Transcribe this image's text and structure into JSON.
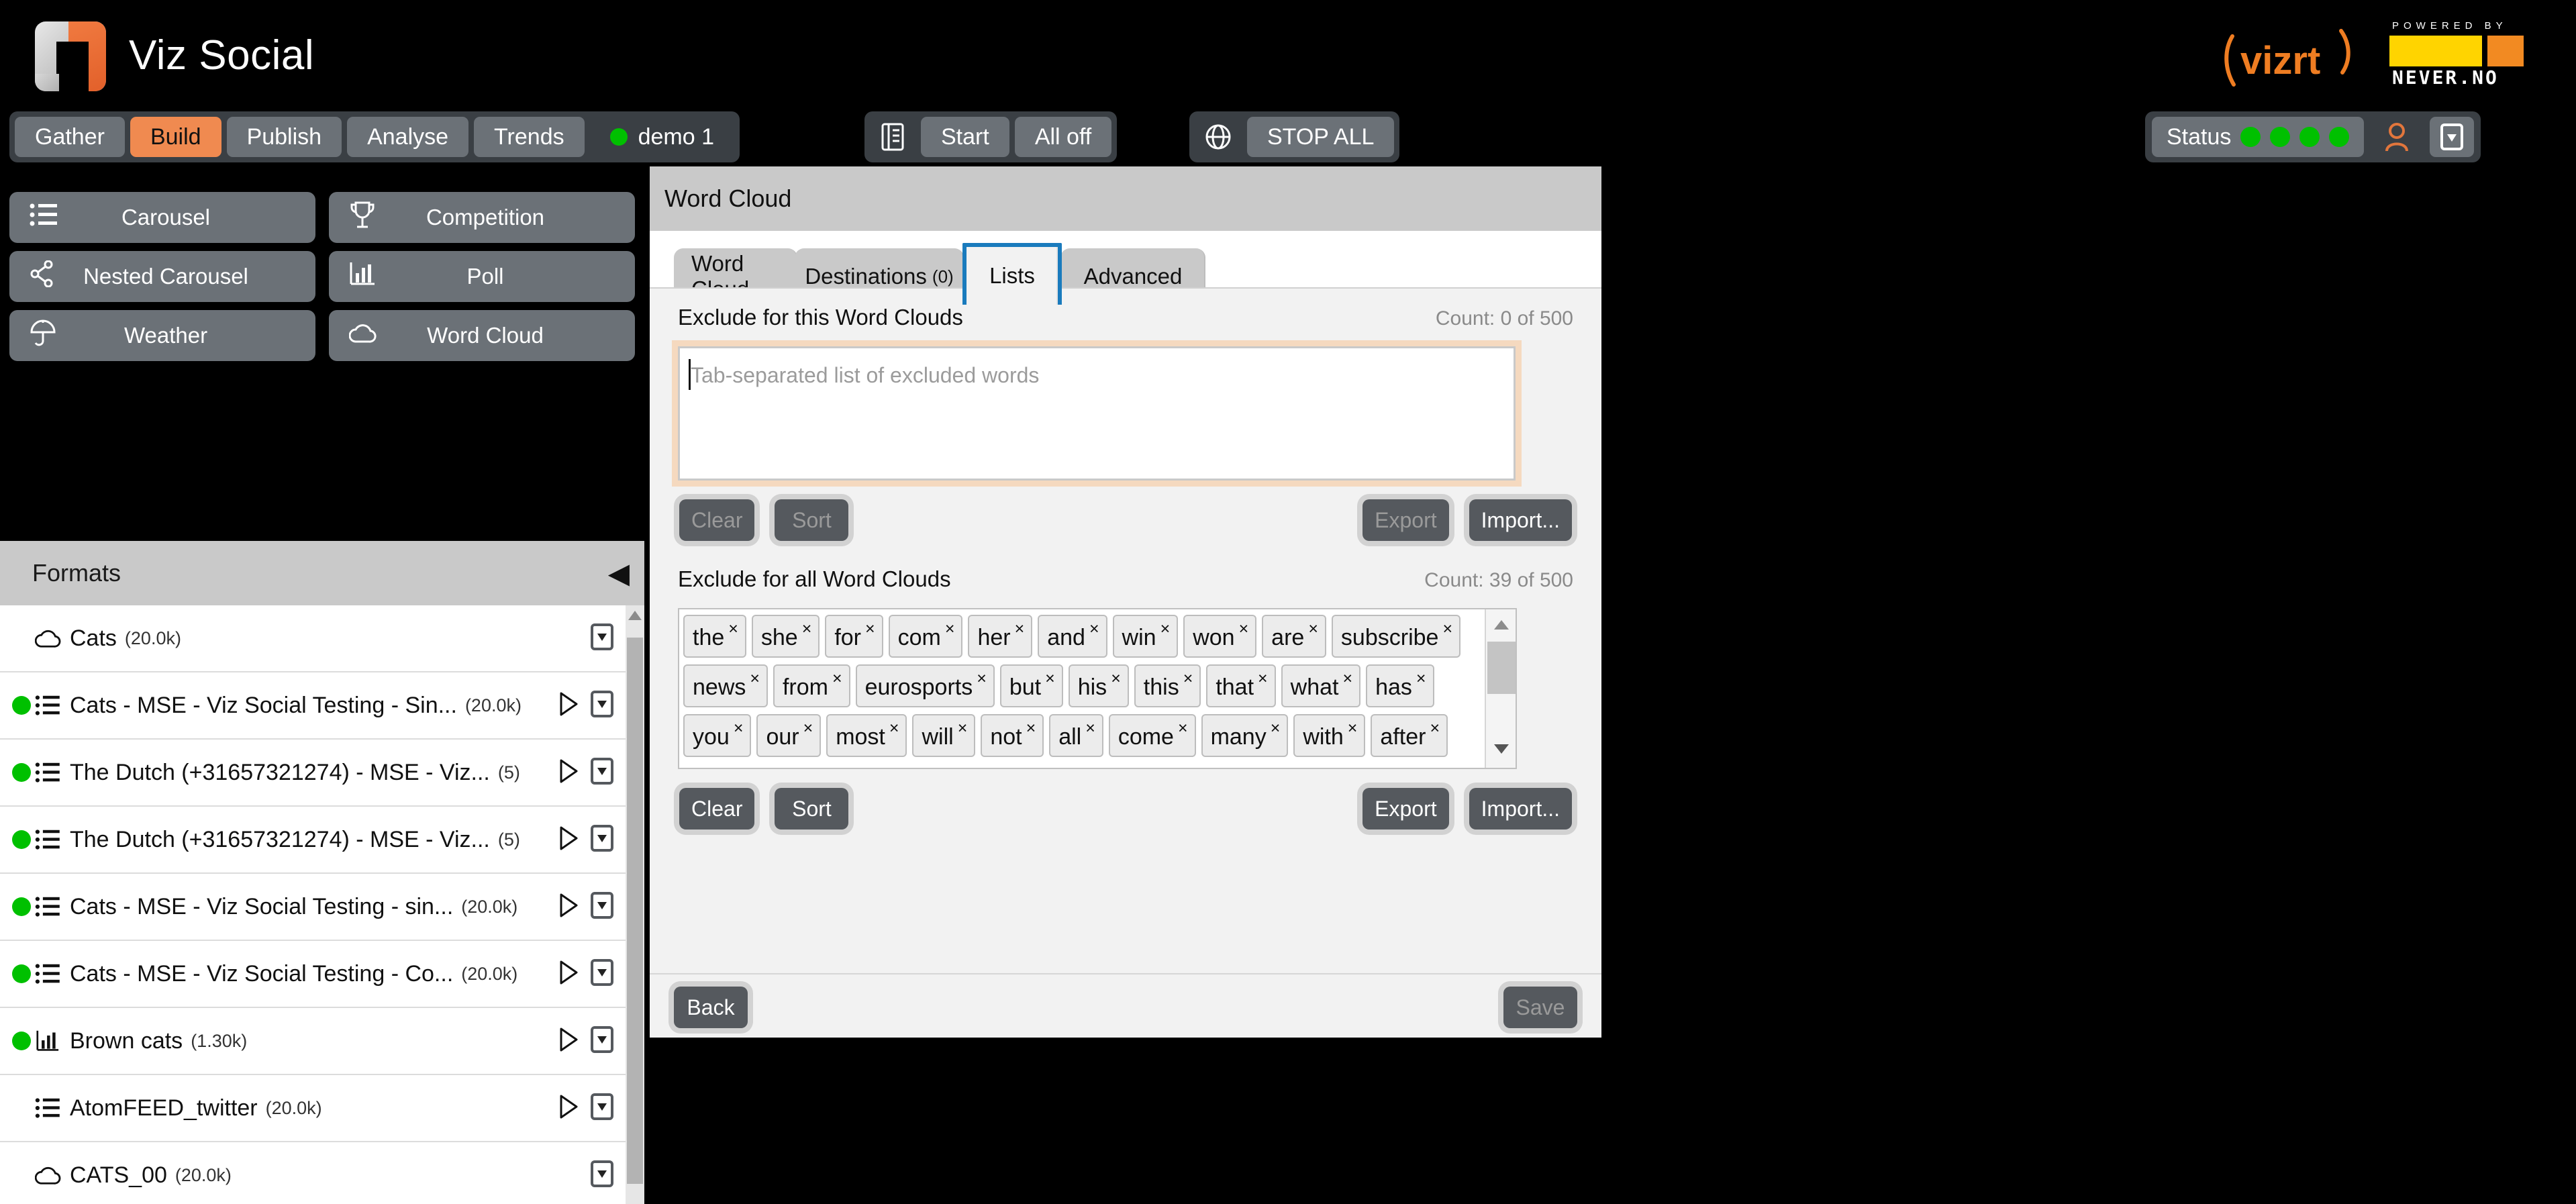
{
  "brand": {
    "app_title": "Viz Social",
    "vizrt_logo": "vizrt",
    "neverno_powered": "POWERED BY",
    "neverno_name": "NEVER.NO"
  },
  "nav": {
    "sections": [
      "Gather",
      "Build",
      "Publish",
      "Analyse",
      "Trends"
    ],
    "active_section": "Build",
    "profile_label": "demo 1",
    "controls": {
      "book_icon": "book-icon",
      "start_label": "Start",
      "all_off_label": "All off",
      "globe_icon": "globe-icon",
      "stop_all_label": "STOP ALL"
    },
    "status": {
      "label": "Status",
      "lights": 4,
      "light_color": "#00c000",
      "user_icon": "user-icon",
      "user_icon_color": "#e2763c",
      "dropdown_icon": "dropdown-box-icon"
    }
  },
  "sidebar": {
    "format_buttons": [
      {
        "label": "Carousel",
        "icon": "list-icon"
      },
      {
        "label": "Competition",
        "icon": "trophy-icon"
      },
      {
        "label": "Nested Carousel",
        "icon": "share-nodes-icon"
      },
      {
        "label": "Poll",
        "icon": "bar-chart-icon"
      },
      {
        "label": "Weather",
        "icon": "umbrella-icon"
      },
      {
        "label": "Word Cloud",
        "icon": "cloud-icon"
      }
    ],
    "formats_header": "Formats",
    "collapse_icon": "chevron-left-icon",
    "items": [
      {
        "name": "Cats",
        "count": "(20.0k)",
        "icon": "cloud-icon",
        "live": false,
        "play": false
      },
      {
        "name": "Cats - MSE - Viz Social Testing - Sin...",
        "count": "(20.0k)",
        "icon": "list-icon",
        "live": true,
        "play": true
      },
      {
        "name": "The Dutch (+31657321274) - MSE - Viz...",
        "count": "(5)",
        "icon": "list-icon",
        "live": true,
        "play": true
      },
      {
        "name": "The Dutch (+31657321274) - MSE - Viz...",
        "count": "(5)",
        "icon": "list-icon",
        "live": true,
        "play": true
      },
      {
        "name": "Cats - MSE - Viz Social Testing - sin...",
        "count": "(20.0k)",
        "icon": "list-icon",
        "live": true,
        "play": true
      },
      {
        "name": "Cats - MSE - Viz Social Testing - Co...",
        "count": "(20.0k)",
        "icon": "list-icon",
        "live": true,
        "play": true
      },
      {
        "name": "Brown cats",
        "count": "(1.30k)",
        "icon": "bar-chart-icon",
        "live": true,
        "play": true
      },
      {
        "name": "AtomFEED_twitter",
        "count": "(20.0k)",
        "icon": "list-icon",
        "live": false,
        "play": true
      },
      {
        "name": "CATS_00",
        "count": "(20.0k)",
        "icon": "cloud-icon",
        "live": false,
        "play": false
      }
    ]
  },
  "main": {
    "header_title": "Word Cloud",
    "tabs": [
      {
        "label": "Word Cloud",
        "sub": "",
        "selected": false
      },
      {
        "label": "Destinations",
        "sub": "(0)",
        "selected": false
      },
      {
        "label": "Lists",
        "sub": "",
        "selected": true
      },
      {
        "label": "Advanced",
        "sub": "",
        "selected": false
      }
    ],
    "selected_tab_accent": "#1a7bbd",
    "this_section": {
      "label": "Exclude for this Word Clouds",
      "count": "Count: 0 of 500",
      "textarea_value": "",
      "textarea_placeholder": "Tab-separated list of excluded words",
      "buttons": {
        "clear": "Clear",
        "sort": "Sort",
        "export": "Export",
        "import": "Import..."
      },
      "buttons_disabled": [
        "Clear",
        "Sort",
        "Export"
      ]
    },
    "all_section": {
      "label": "Exclude for all Word Clouds",
      "count": "Count: 39 of 500",
      "words": [
        "the",
        "she",
        "for",
        "com",
        "her",
        "and",
        "win",
        "won",
        "are",
        "subscribe",
        "news",
        "from",
        "eurosports",
        "but",
        "his",
        "this",
        "that",
        "what",
        "has",
        "you",
        "our",
        "most",
        "will",
        "not",
        "all",
        "come",
        "many",
        "with",
        "after"
      ],
      "remove_icon": "close-x-icon",
      "buttons": {
        "clear": "Clear",
        "sort": "Sort",
        "export": "Export",
        "import": "Import..."
      },
      "buttons_disabled": []
    },
    "footer": {
      "back": "Back",
      "save": "Save",
      "save_disabled": true
    }
  }
}
